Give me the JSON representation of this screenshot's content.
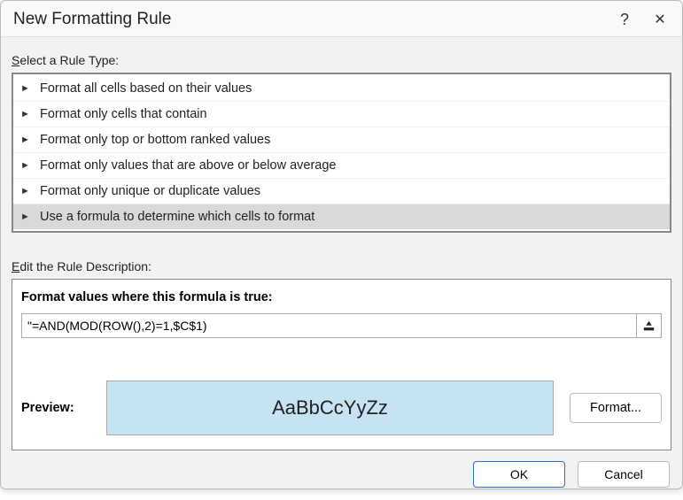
{
  "titlebar": {
    "title": "New Formatting Rule",
    "help": "?",
    "close": "✕"
  },
  "labels": {
    "select_rule_type_prefix": "S",
    "select_rule_type_rest": "elect a Rule Type:",
    "edit_prefix": "E",
    "edit_rest": "dit the Rule Description:",
    "formula_label_prefix": "F",
    "formula_label_u": "o",
    "formula_label_rest": "rmat values where this formula is true:",
    "preview": "Preview:",
    "format_btn_prefix": "F",
    "format_btn_u": "o",
    "format_btn_rest": "rmat...",
    "ok": "OK",
    "cancel": "Cancel"
  },
  "rules": [
    {
      "text": "Format all cells based on their values",
      "selected": false
    },
    {
      "text": "Format only cells that contain",
      "selected": false
    },
    {
      "text": "Format only top or bottom ranked values",
      "selected": false
    },
    {
      "text": "Format only values that are above or below average",
      "selected": false
    },
    {
      "text": "Format only unique or duplicate values",
      "selected": false
    },
    {
      "text": "Use a formula to determine which cells to format",
      "selected": true
    }
  ],
  "formula": {
    "value": "\"=AND(MOD(ROW(),2)=1,$C$1)"
  },
  "preview": {
    "sample": "AaBbCcYyZz"
  }
}
